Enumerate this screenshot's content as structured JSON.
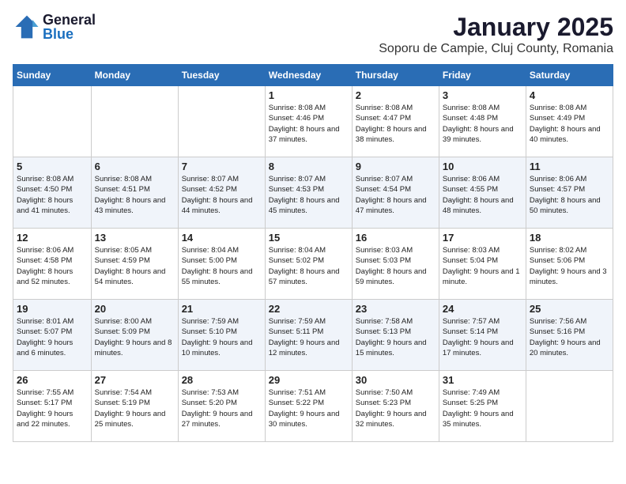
{
  "header": {
    "logo_general": "General",
    "logo_blue": "Blue",
    "title": "January 2025",
    "subtitle": "Soporu de Campie, Cluj County, Romania"
  },
  "weekdays": [
    "Sunday",
    "Monday",
    "Tuesday",
    "Wednesday",
    "Thursday",
    "Friday",
    "Saturday"
  ],
  "weeks": [
    [
      {
        "day": "",
        "info": ""
      },
      {
        "day": "",
        "info": ""
      },
      {
        "day": "",
        "info": ""
      },
      {
        "day": "1",
        "info": "Sunrise: 8:08 AM\nSunset: 4:46 PM\nDaylight: 8 hours and 37 minutes."
      },
      {
        "day": "2",
        "info": "Sunrise: 8:08 AM\nSunset: 4:47 PM\nDaylight: 8 hours and 38 minutes."
      },
      {
        "day": "3",
        "info": "Sunrise: 8:08 AM\nSunset: 4:48 PM\nDaylight: 8 hours and 39 minutes."
      },
      {
        "day": "4",
        "info": "Sunrise: 8:08 AM\nSunset: 4:49 PM\nDaylight: 8 hours and 40 minutes."
      }
    ],
    [
      {
        "day": "5",
        "info": "Sunrise: 8:08 AM\nSunset: 4:50 PM\nDaylight: 8 hours and 41 minutes."
      },
      {
        "day": "6",
        "info": "Sunrise: 8:08 AM\nSunset: 4:51 PM\nDaylight: 8 hours and 43 minutes."
      },
      {
        "day": "7",
        "info": "Sunrise: 8:07 AM\nSunset: 4:52 PM\nDaylight: 8 hours and 44 minutes."
      },
      {
        "day": "8",
        "info": "Sunrise: 8:07 AM\nSunset: 4:53 PM\nDaylight: 8 hours and 45 minutes."
      },
      {
        "day": "9",
        "info": "Sunrise: 8:07 AM\nSunset: 4:54 PM\nDaylight: 8 hours and 47 minutes."
      },
      {
        "day": "10",
        "info": "Sunrise: 8:06 AM\nSunset: 4:55 PM\nDaylight: 8 hours and 48 minutes."
      },
      {
        "day": "11",
        "info": "Sunrise: 8:06 AM\nSunset: 4:57 PM\nDaylight: 8 hours and 50 minutes."
      }
    ],
    [
      {
        "day": "12",
        "info": "Sunrise: 8:06 AM\nSunset: 4:58 PM\nDaylight: 8 hours and 52 minutes."
      },
      {
        "day": "13",
        "info": "Sunrise: 8:05 AM\nSunset: 4:59 PM\nDaylight: 8 hours and 54 minutes."
      },
      {
        "day": "14",
        "info": "Sunrise: 8:04 AM\nSunset: 5:00 PM\nDaylight: 8 hours and 55 minutes."
      },
      {
        "day": "15",
        "info": "Sunrise: 8:04 AM\nSunset: 5:02 PM\nDaylight: 8 hours and 57 minutes."
      },
      {
        "day": "16",
        "info": "Sunrise: 8:03 AM\nSunset: 5:03 PM\nDaylight: 8 hours and 59 minutes."
      },
      {
        "day": "17",
        "info": "Sunrise: 8:03 AM\nSunset: 5:04 PM\nDaylight: 9 hours and 1 minute."
      },
      {
        "day": "18",
        "info": "Sunrise: 8:02 AM\nSunset: 5:06 PM\nDaylight: 9 hours and 3 minutes."
      }
    ],
    [
      {
        "day": "19",
        "info": "Sunrise: 8:01 AM\nSunset: 5:07 PM\nDaylight: 9 hours and 6 minutes."
      },
      {
        "day": "20",
        "info": "Sunrise: 8:00 AM\nSunset: 5:09 PM\nDaylight: 9 hours and 8 minutes."
      },
      {
        "day": "21",
        "info": "Sunrise: 7:59 AM\nSunset: 5:10 PM\nDaylight: 9 hours and 10 minutes."
      },
      {
        "day": "22",
        "info": "Sunrise: 7:59 AM\nSunset: 5:11 PM\nDaylight: 9 hours and 12 minutes."
      },
      {
        "day": "23",
        "info": "Sunrise: 7:58 AM\nSunset: 5:13 PM\nDaylight: 9 hours and 15 minutes."
      },
      {
        "day": "24",
        "info": "Sunrise: 7:57 AM\nSunset: 5:14 PM\nDaylight: 9 hours and 17 minutes."
      },
      {
        "day": "25",
        "info": "Sunrise: 7:56 AM\nSunset: 5:16 PM\nDaylight: 9 hours and 20 minutes."
      }
    ],
    [
      {
        "day": "26",
        "info": "Sunrise: 7:55 AM\nSunset: 5:17 PM\nDaylight: 9 hours and 22 minutes."
      },
      {
        "day": "27",
        "info": "Sunrise: 7:54 AM\nSunset: 5:19 PM\nDaylight: 9 hours and 25 minutes."
      },
      {
        "day": "28",
        "info": "Sunrise: 7:53 AM\nSunset: 5:20 PM\nDaylight: 9 hours and 27 minutes."
      },
      {
        "day": "29",
        "info": "Sunrise: 7:51 AM\nSunset: 5:22 PM\nDaylight: 9 hours and 30 minutes."
      },
      {
        "day": "30",
        "info": "Sunrise: 7:50 AM\nSunset: 5:23 PM\nDaylight: 9 hours and 32 minutes."
      },
      {
        "day": "31",
        "info": "Sunrise: 7:49 AM\nSunset: 5:25 PM\nDaylight: 9 hours and 35 minutes."
      },
      {
        "day": "",
        "info": ""
      }
    ]
  ]
}
